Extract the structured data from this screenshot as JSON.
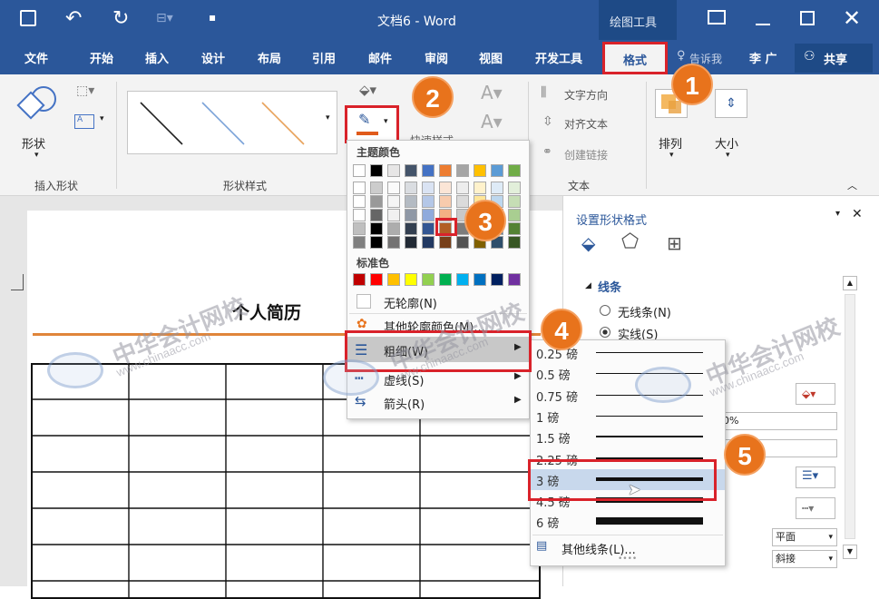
{
  "titlebar": {
    "doc_title": "文档6 - Word",
    "context_group": "绘图工具"
  },
  "tabs": [
    "文件",
    "开始",
    "插入",
    "设计",
    "布局",
    "引用",
    "邮件",
    "审阅",
    "视图",
    "开发工具",
    "格式"
  ],
  "tell_me": "告诉我",
  "user": "李 广",
  "share": "共享",
  "ribbon": {
    "shape_btn": "形状",
    "group_insert_shapes": "插入形状",
    "group_shape_styles": "形状样式",
    "text_direction": "文字方向",
    "align_text": "对齐文本",
    "create_link": "创建链接",
    "group_text": "文本",
    "arrange": "排列",
    "size": "大小",
    "art_label": "快速样式"
  },
  "outline_menu": {
    "theme_colors": "主题颜色",
    "standard_colors": "标准色",
    "no_outline": "无轮廓(N)",
    "more_colors": "其他轮廓颜色(M)...",
    "weight": "粗细(W)",
    "dashes": "虚线(S)",
    "arrows": "箭头(R)",
    "standard_swatches": [
      "#c00000",
      "#ff0000",
      "#ffc000",
      "#ffff00",
      "#92d050",
      "#00b050",
      "#00b0f0",
      "#0070c0",
      "#002060",
      "#7030a0"
    ],
    "theme_top": [
      "#ffffff",
      "#000000",
      "#e7e6e6",
      "#44546a",
      "#4472c4",
      "#ed7d31",
      "#a5a5a5",
      "#ffc000",
      "#5b9bd5",
      "#70ad47"
    ]
  },
  "weights": [
    {
      "label": "0.25 磅",
      "pt": 0.25
    },
    {
      "label": "0.5 磅",
      "pt": 0.5
    },
    {
      "label": "0.75 磅",
      "pt": 0.75
    },
    {
      "label": "1 磅",
      "pt": 1
    },
    {
      "label": "1.5 磅",
      "pt": 1.5
    },
    {
      "label": "2.25 磅",
      "pt": 2.25
    },
    {
      "label": "3 磅",
      "pt": 3
    },
    {
      "label": "4.5 磅",
      "pt": 4.5
    },
    {
      "label": "6 磅",
      "pt": 6
    }
  ],
  "more_lines": "其他线条(L)...",
  "pane": {
    "title": "设置形状格式",
    "section": "线条",
    "no_line": "无线条(N)",
    "solid_line": "实线(S)",
    "transparency_value": "0%",
    "cap_value": "平面",
    "join_value": "斜接"
  },
  "document": {
    "heading": "个人简历"
  },
  "steps": [
    "1",
    "2",
    "3",
    "4",
    "5"
  ],
  "watermark": {
    "cn": "中华会计网校",
    "url": "www.chinaacc.com"
  },
  "colors": {
    "accent": "#2b579a",
    "highlight": "#d9222a",
    "badge": "#e8731c",
    "line_orange": "#e0853a"
  }
}
